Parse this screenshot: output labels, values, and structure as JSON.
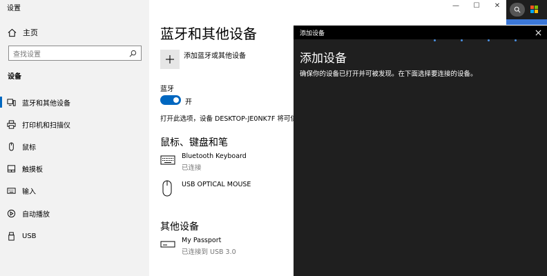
{
  "window": {
    "title": "设置",
    "minimize": "—",
    "maximize": "☐",
    "close": "✕"
  },
  "sidebar": {
    "home": "主页",
    "search_placeholder": "查找设置",
    "section": "设备",
    "items": [
      {
        "label": "蓝牙和其他设备",
        "icon": "bluetooth-devices-icon",
        "active": true
      },
      {
        "label": "打印机和扫描仪",
        "icon": "printer-icon"
      },
      {
        "label": "鼠标",
        "icon": "mouse-icon"
      },
      {
        "label": "触摸板",
        "icon": "touchpad-icon"
      },
      {
        "label": "输入",
        "icon": "keyboard-icon"
      },
      {
        "label": "自动播放",
        "icon": "autoplay-icon"
      },
      {
        "label": "USB",
        "icon": "usb-icon"
      }
    ]
  },
  "main": {
    "title": "蓝牙和其他设备",
    "add_device": "添加蓝牙或其他设备",
    "bluetooth_label": "蓝牙",
    "bluetooth_state": "开",
    "discoverable_text": "打开此选项，设备 DESKTOP-JE0NK7F 将可供其",
    "mouse_section": "鼠标、键盘和笔",
    "devices": [
      {
        "name": "Bluetooth Keyboard",
        "status": "已连接",
        "icon": "keyboard-icon"
      },
      {
        "name": "USB OPTICAL MOUSE",
        "status": "",
        "icon": "mouse-icon"
      }
    ],
    "other_section": "其他设备",
    "other_devices": [
      {
        "name": "My Passport",
        "status": "已连接到 USB 3.0",
        "icon": "drive-icon"
      }
    ]
  },
  "dialog": {
    "header": "添加设备",
    "heading": "添加设备",
    "description": "确保你的设备已打开并可被发现。在下面选择要连接的设备。"
  },
  "colors": {
    "accent": "#0067c0",
    "dialog_bg": "#1f1f1f",
    "sidebar_bg": "#f2f2f2"
  }
}
